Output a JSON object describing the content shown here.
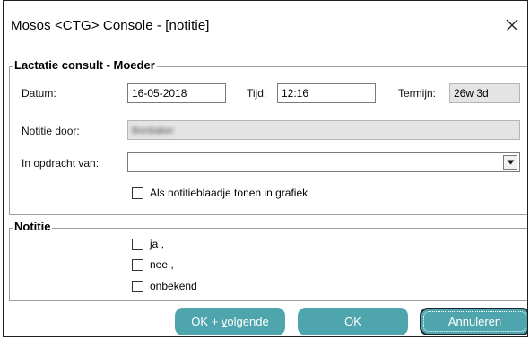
{
  "window": {
    "title": "Mosos <CTG> Console - [notitie]"
  },
  "lactatie": {
    "group_label": "Lactatie consult - Moeder",
    "datum_label": "Datum:",
    "datum_value": "16-05-2018",
    "tijd_label": "Tijd:",
    "tijd_value": "12:16",
    "termijn_label": "Termijn:",
    "termijn_value": "26w 3d",
    "notitie_door_label": "Notitie door:",
    "notitie_door_value": "Bonbaker",
    "opdracht_label": "In opdracht van:",
    "opdracht_value": "",
    "toon_label": "Als notitieblaadje tonen in grafiek",
    "toon_checked": false
  },
  "notitie": {
    "group_label": "Notitie",
    "options": [
      {
        "label": "ja ,",
        "checked": false
      },
      {
        "label": "nee ,",
        "checked": false
      },
      {
        "label": "onbekend",
        "checked": false
      }
    ]
  },
  "buttons": {
    "ok_volgende_prefix": "OK + ",
    "ok_volgende_underlined": "v",
    "ok_volgende_suffix": "olgende",
    "ok": "OK",
    "annuleren": "Annuleren"
  },
  "colors": {
    "button_bg": "#4ea5ad",
    "button_text": "#ffffff",
    "readonly_bg": "#e4e4e4"
  }
}
